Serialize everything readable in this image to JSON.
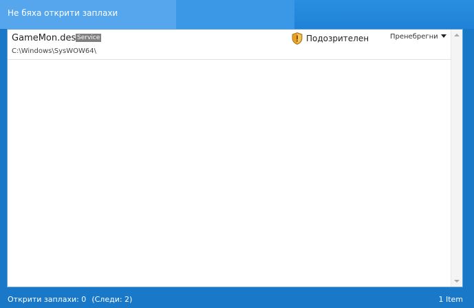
{
  "header": {
    "title": "Не бяха открити заплахи"
  },
  "results": {
    "items": [
      {
        "filename": "GameMon.des",
        "badge": "Service",
        "path": "C:\\Windows\\SysWOW64\\",
        "status": "Подозрителен",
        "status_icon": "warning-shield-icon",
        "action": "Пренебрегни"
      }
    ]
  },
  "footer": {
    "threats_found": "Открити заплахи: 0",
    "traces": "(Следи: 2)",
    "item_count": "1 Item"
  },
  "colors": {
    "window_blue": "#1a78c8",
    "header_highlight": "#55a6ec",
    "badge_gray": "#808080",
    "shield_orange": "#e8a020"
  }
}
